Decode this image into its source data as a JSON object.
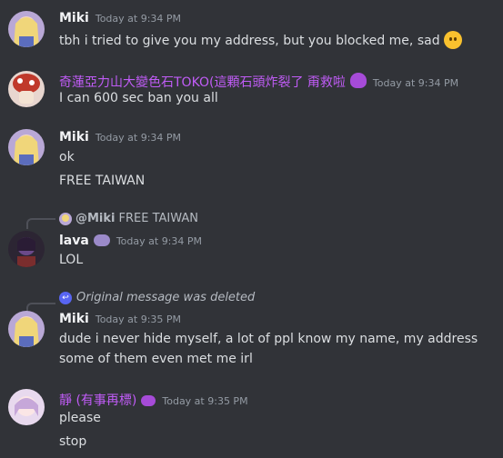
{
  "messages": [
    {
      "author": "Miki",
      "time": "Today at 9:34 PM",
      "lines": [
        "tbh i tried to give you my address, but you blocked me, sad"
      ]
    },
    {
      "author": "奇蓮亞力山大變色石TOKO(這顆石頭炸裂了 甭救啦",
      "time": "Today at 9:34 PM",
      "lines": [
        "I can 600 sec ban you all"
      ]
    },
    {
      "author": "Miki",
      "time": "Today at 9:34 PM",
      "lines": [
        "ok",
        "FREE TAIWAN"
      ]
    },
    {
      "reply_author": "@Miki",
      "reply_text": "FREE TAIWAN",
      "author": "lava",
      "time": "Today at 9:34 PM",
      "lines": [
        "LOL"
      ]
    },
    {
      "reply_text": "Original message was deleted",
      "author": "Miki",
      "time": "Today at 9:35 PM",
      "lines": [
        "dude i never hide myself, a lot of ppl know my name, my address",
        "some of them even met me irl"
      ]
    },
    {
      "author": "靜 (有事再標)",
      "time": "Today at 9:35 PM",
      "lines": [
        "please",
        "stop"
      ]
    }
  ],
  "colors": {
    "background": "#313338",
    "username": "#f2f3f5",
    "purple_name": "#c05cf6",
    "timestamp": "#949ba4"
  },
  "icons": {
    "sad_emoji": "frowning-face-emoji",
    "deleted_reply": "reply-arrow-icon",
    "role_badge": "role-badge-icon"
  }
}
